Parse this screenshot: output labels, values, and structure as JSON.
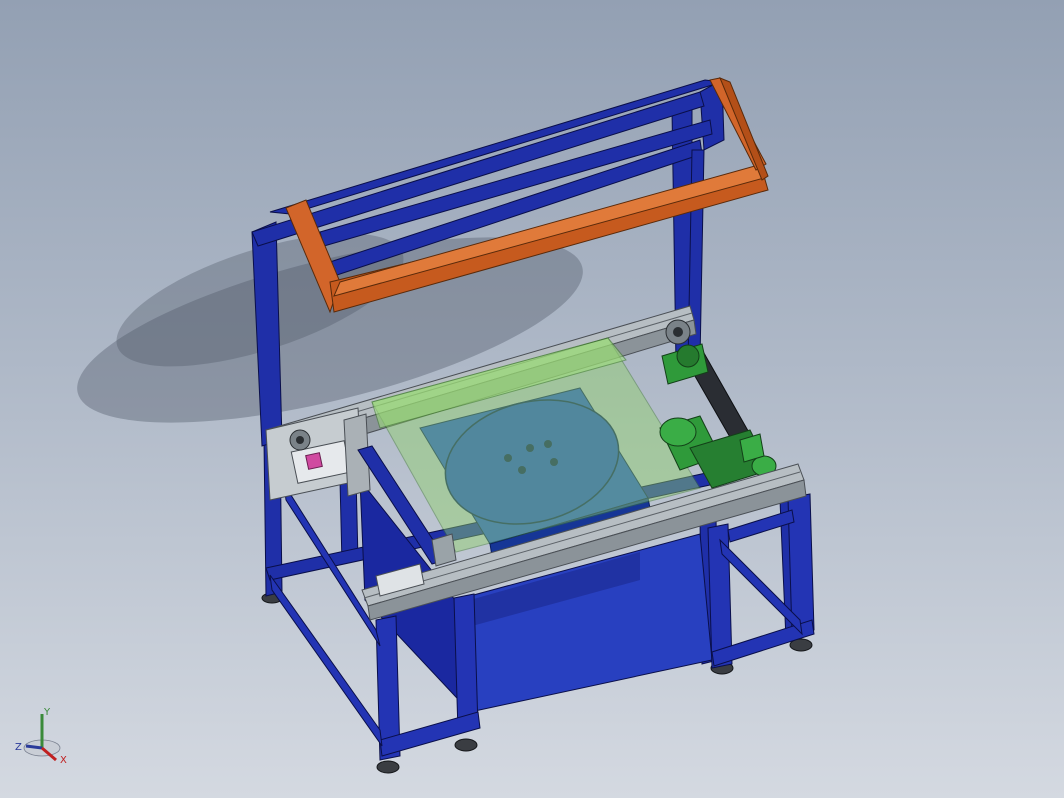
{
  "viewport": {
    "background_top": "#93a0b3",
    "background_bottom": "#d4d9e1"
  },
  "model": {
    "frame_color": "#1f2fa8",
    "frame_dark": "#131e78",
    "hood_color": "#c65a1e",
    "rail_color": "#9aa3a8",
    "glass_color": "#8fd16a",
    "turntable_color": "#1f4bc8",
    "motor_color": "#2f9a3a"
  },
  "triad": {
    "x_label": "X",
    "y_label": "Y",
    "z_label": "Z",
    "x_color": "#c02020",
    "y_color": "#3a8a3a",
    "z_color": "#2a3a9a"
  }
}
